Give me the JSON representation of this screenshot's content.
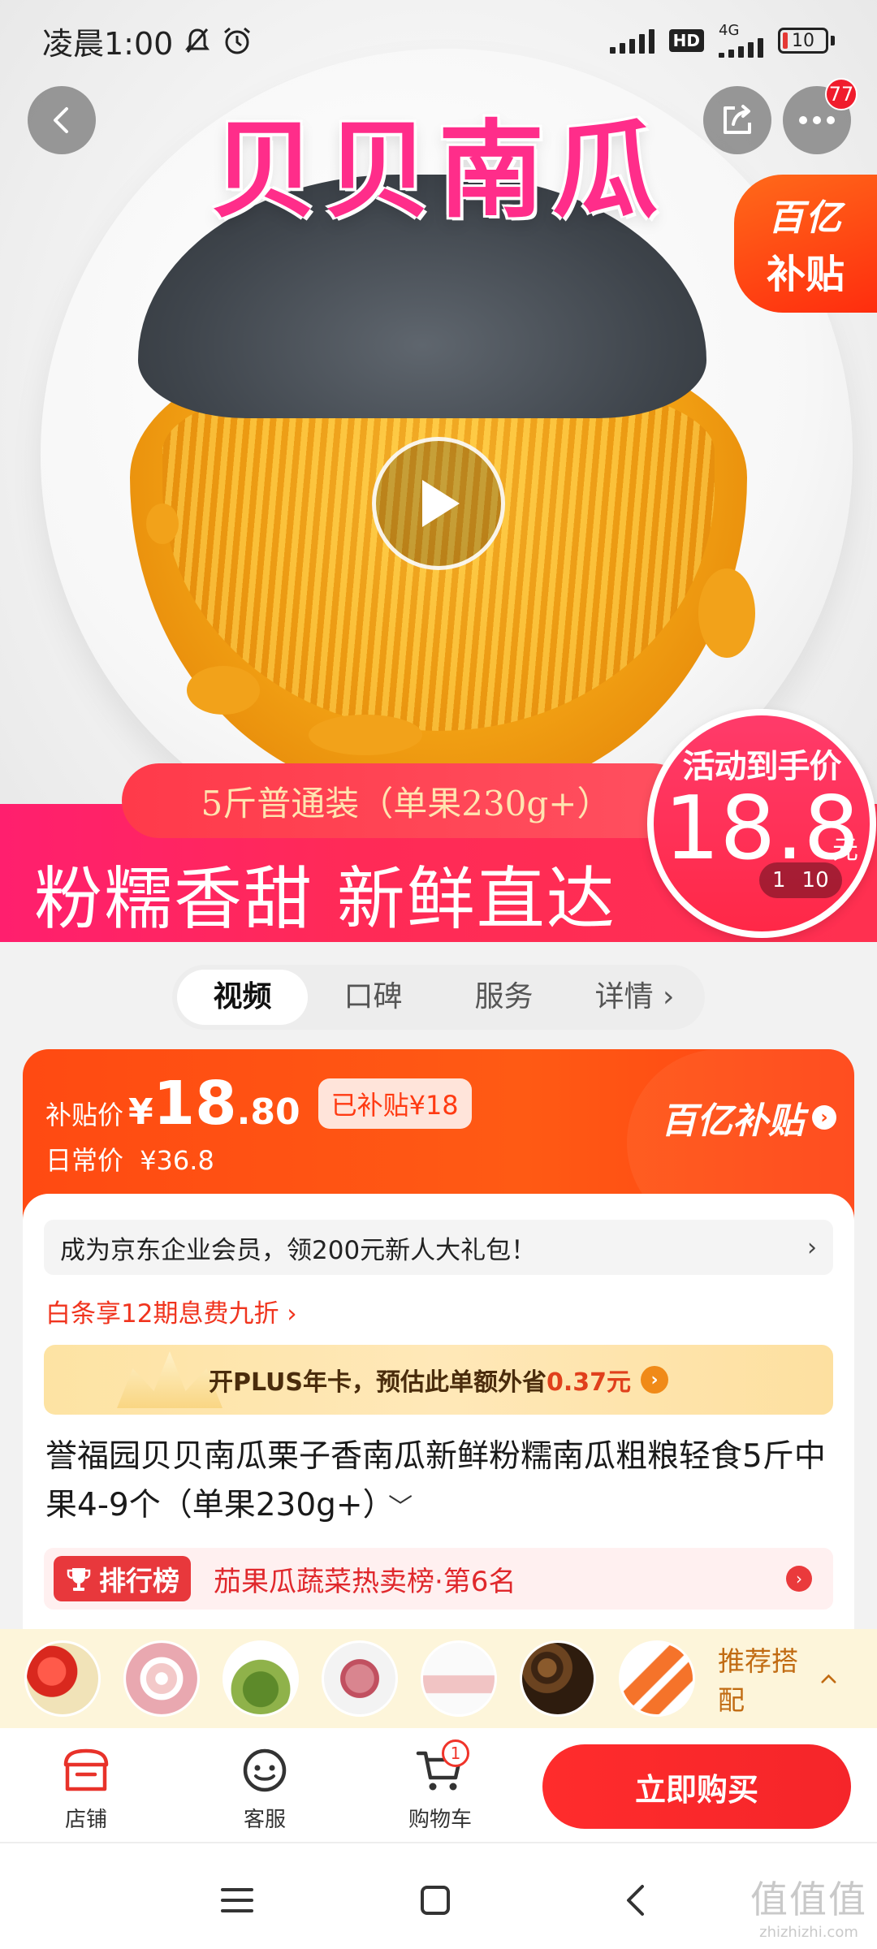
{
  "status_bar": {
    "time": "凌晨1:00",
    "network_type": "4G",
    "hd_label": "HD",
    "battery": "10"
  },
  "hero": {
    "title": "贝贝南瓜",
    "subsidy_tag_line1": "百亿",
    "subsidy_tag_line2": "补贴",
    "pack_pill": "5斤普通装（单果230g+）",
    "slogan": "粉糯香甜 新鲜直达",
    "activity_price_label": "活动到手价",
    "activity_price": "18.8",
    "activity_price_unit": "元",
    "counter_current": "1",
    "counter_total": "10",
    "more_badge": "77"
  },
  "tabs": [
    {
      "label": "视频",
      "active": true
    },
    {
      "label": "口碑",
      "active": false
    },
    {
      "label": "服务",
      "active": false
    },
    {
      "label": "详情 ›",
      "active": false
    }
  ],
  "price_card": {
    "subsidy_price_label": "补贴价",
    "currency": "¥",
    "price_int": "18",
    "price_dec": ".80",
    "subsidized_badge": "已补贴¥18",
    "daily_price_label": "日常价",
    "daily_price": "¥36.8",
    "brand_label": "百亿补贴"
  },
  "info": {
    "member_promo": "成为京东企业会员，领200元新人大礼包！",
    "member_chevron": "›",
    "baitiao": "白条享12期息费九折 ›",
    "plus_text_pre": "开PLUS年卡，预估此单额外省",
    "plus_amount": "0.37元",
    "product_title": "誉福园贝贝南瓜栗子香南瓜新鲜粉糯南瓜粗粮轻食5斤中果4-9个（单果230g+）",
    "title_expand": "﹀",
    "rank_tag": "排行榜",
    "rank_text": "茄果瓜蔬菜热卖榜·第6名"
  },
  "recommend": {
    "label": "推荐搭配",
    "chevron": "^"
  },
  "bottom_bar": {
    "shop_label": "店铺",
    "service_label": "客服",
    "cart_label": "购物车",
    "cart_count": "1",
    "buy_label": "立即购买"
  },
  "watermark": {
    "big": "值值值",
    "small": "zhizhizhi.com"
  },
  "colors": {
    "brand_red": "#ff2c2c",
    "subsidy_orange": "#ff4a12",
    "hero_pink": "#ff2d8a"
  }
}
